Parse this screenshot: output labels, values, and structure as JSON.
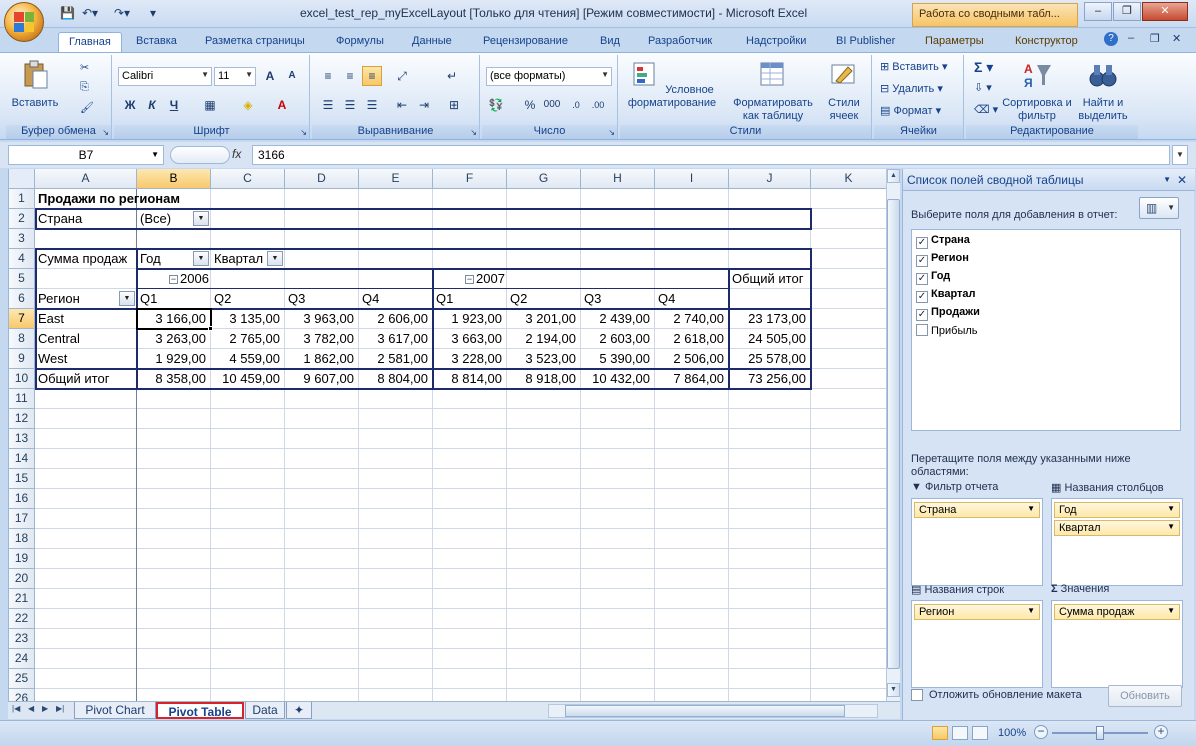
{
  "window": {
    "title": "excel_test_rep_myExcelLayout  [Только для чтения]  [Режим совместимости] - Microsoft Excel",
    "context_title": "Работа со сводными табл...",
    "minimize": "–",
    "restore": "❐",
    "close": "✕"
  },
  "ribbon_tabs": [
    "Главная",
    "Вставка",
    "Разметка страницы",
    "Формулы",
    "Данные",
    "Рецензирование",
    "Вид",
    "Разработчик",
    "Надстройки",
    "BI Publisher",
    "Параметры",
    "Конструктор"
  ],
  "ribbon": {
    "clipboard": {
      "label": "Буфер обмена",
      "paste": "Вставить"
    },
    "font": {
      "label": "Шрифт",
      "name": "Calibri",
      "size": "11",
      "bold": "Ж",
      "italic": "К",
      "underline": "Ч",
      "grow": "A",
      "shrink": "A"
    },
    "alignment": {
      "label": "Выравнивание"
    },
    "number": {
      "label": "Число",
      "format": "(все форматы)",
      "percent": "%",
      "thousands": "000"
    },
    "styles": {
      "label": "Стили",
      "conditional": "Условное форматирование",
      "as_table": "Форматировать как таблицу",
      "cell_styles": "Стили ячеек"
    },
    "cells": {
      "label": "Ячейки",
      "insert": "Вставить",
      "delete": "Удалить",
      "format": "Формат"
    },
    "editing": {
      "label": "Редактирование",
      "sort": "Сортировка и фильтр",
      "find": "Найти и выделить"
    }
  },
  "formula_bar": {
    "name_box": "B7",
    "fx": "fx",
    "value": "3166"
  },
  "columns": [
    "A",
    "B",
    "C",
    "D",
    "E",
    "F",
    "G",
    "H",
    "I",
    "J",
    "K"
  ],
  "rows": [
    "1",
    "2",
    "3",
    "4",
    "5",
    "6",
    "7",
    "8",
    "9",
    "10",
    "11",
    "12",
    "13",
    "14",
    "15",
    "16",
    "17",
    "18",
    "19",
    "20",
    "21",
    "22",
    "23",
    "24",
    "25",
    "26"
  ],
  "sheet": {
    "title": "Продажи по регионам",
    "filter_label": "Страна",
    "filter_value": "(Все)",
    "values_label": "Сумма продаж",
    "col_field_year": "Год",
    "col_field_quarter": "Квартал",
    "year_2006": "2006",
    "year_2007": "2007",
    "grand_total_header": "Общий итог",
    "row_field": "Регион",
    "quarters": [
      "Q1",
      "Q2",
      "Q3",
      "Q4",
      "Q1",
      "Q2",
      "Q3",
      "Q4"
    ],
    "data_rows": [
      {
        "label": "East",
        "values": [
          "3 166,00",
          "3 135,00",
          "3 963,00",
          "2 606,00",
          "1 923,00",
          "3 201,00",
          "2 439,00",
          "2 740,00"
        ],
        "total": "23 173,00"
      },
      {
        "label": "Central",
        "values": [
          "3 263,00",
          "2 765,00",
          "3 782,00",
          "3 617,00",
          "3 663,00",
          "2 194,00",
          "2 603,00",
          "2 618,00"
        ],
        "total": "24 505,00"
      },
      {
        "label": "West",
        "values": [
          "1 929,00",
          "4 559,00",
          "1 862,00",
          "2 581,00",
          "3 228,00",
          "3 523,00",
          "5 390,00",
          "2 506,00"
        ],
        "total": "25 578,00"
      }
    ],
    "grand_total_row": {
      "label": "Общий итог",
      "values": [
        "8 358,00",
        "10 459,00",
        "9 607,00",
        "8 804,00",
        "8 814,00",
        "8 918,00",
        "10 432,00",
        "7 864,00"
      ],
      "total": "73 256,00"
    }
  },
  "sheet_tabs": [
    "Pivot Chart",
    "Pivot Table",
    "Data"
  ],
  "status": {
    "zoom": "100%"
  },
  "field_pane": {
    "title": "Список полей сводной таблицы",
    "choose_label": "Выберите поля для добавления в отчет:",
    "fields": [
      {
        "name": "Страна",
        "checked": true
      },
      {
        "name": "Регион",
        "checked": true
      },
      {
        "name": "Год",
        "checked": true
      },
      {
        "name": "Квартал",
        "checked": true
      },
      {
        "name": "Продажи",
        "checked": true
      },
      {
        "name": "Прибыль",
        "checked": false
      }
    ],
    "drag_label": "Перетащите поля между указанными ниже областями:",
    "report_filter": {
      "title": "Фильтр отчета",
      "items": [
        "Страна"
      ]
    },
    "column_labels": {
      "title": "Названия столбцов",
      "items": [
        "Год",
        "Квартал"
      ]
    },
    "row_labels": {
      "title": "Названия строк",
      "items": [
        "Регион"
      ]
    },
    "values": {
      "title": "Значения",
      "items": [
        "Сумма продаж"
      ]
    },
    "defer_label": "Отложить обновление макета",
    "update_button": "Обновить"
  }
}
